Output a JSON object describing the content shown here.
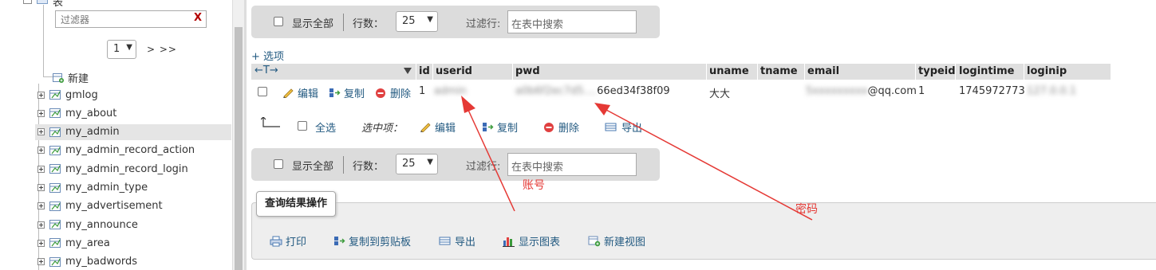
{
  "sidebar": {
    "tree_root_label": "表",
    "filter_placeholder": "过滤器",
    "filter_clear": "X",
    "page_select": "1",
    "page_next": "> >>",
    "new_table": "新建",
    "tables": [
      "gmlog",
      "my_about",
      "my_admin",
      "my_admin_record_action",
      "my_admin_record_login",
      "my_admin_type",
      "my_advertisement",
      "my_announce",
      "my_area",
      "my_badwords"
    ],
    "selected_table": "my_admin"
  },
  "navbar": {
    "show_all": "显示全部",
    "rows_label": "行数：",
    "rows_value": "25",
    "filter_label": "过滤行:",
    "filter_placeholder": "在表中搜索"
  },
  "options_link": "+ 选项",
  "table": {
    "columns": [
      "id",
      "userid",
      "pwd",
      "uname",
      "tname",
      "email",
      "typeid",
      "logintime",
      "loginip"
    ],
    "actions": {
      "edit": "编辑",
      "copy": "复制",
      "delete": "删除"
    },
    "row": {
      "id": "1",
      "userid": "admin",
      "pwd": "a0b6f2ec7d5...66ed34f38f09",
      "pwd_visible": "66ed34f38f09",
      "uname": "大大",
      "tname": "",
      "email_visible": "@qq.com",
      "typeid": "1",
      "logintime": "1745972773",
      "loginip": "127.0.0.1"
    }
  },
  "bulk": {
    "select_all": "全选",
    "selected_items": "选中项：",
    "edit": "编辑",
    "copy": "复制",
    "delete": "删除",
    "export": "导出"
  },
  "query_ops": {
    "legend": "查询结果操作",
    "print": "打印",
    "copy_clipboard": "复制到剪贴板",
    "export": "导出",
    "show_chart": "显示图表",
    "create_view": "新建视图"
  },
  "annotations": {
    "account": "账号",
    "password": "密码",
    "color": "#e53935"
  },
  "colors": {
    "link": "#235a81",
    "navbar_bg": "#dcdcdc",
    "header_bg": "#dfdfdf",
    "selected_bg": "#e5e5e5"
  }
}
